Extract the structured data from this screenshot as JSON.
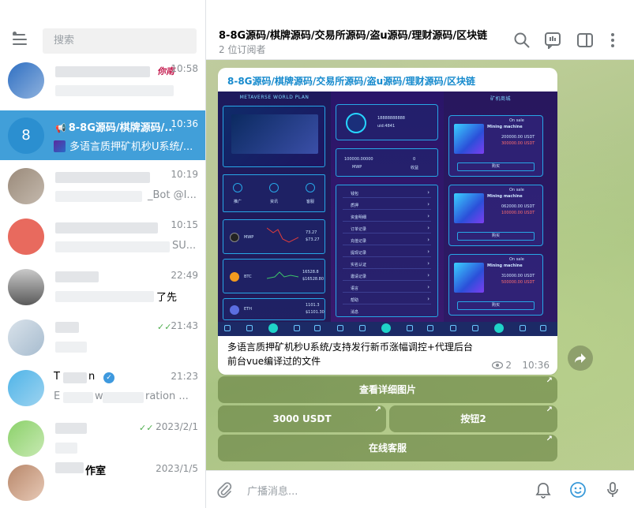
{
  "sidebar": {
    "search_placeholder": "搜索",
    "chats": [
      {
        "time": "10:58",
        "tag": "你南"
      },
      {
        "avatar_letter": "8",
        "title": "8-8G源码/棋牌源码/...",
        "preview": "多语言质押矿机秒U系统/...",
        "time": "10:36"
      },
      {
        "time": "10:19",
        "preview_visible": "_Bot @I..."
      },
      {
        "time": "10:15",
        "preview_visible": "SU..."
      },
      {
        "time": "22:49",
        "preview_visible": "了先"
      },
      {
        "time": "21:43"
      },
      {
        "name_visible": "T",
        "name_visible_end": "n",
        "time": "21:23",
        "preview_visible_start": "E",
        "preview_visible_mid": "w",
        "preview_visible_end": "ration ..."
      },
      {
        "time": "2023/2/1"
      },
      {
        "name_visible": "作室",
        "time": "2023/1/5"
      }
    ]
  },
  "header": {
    "title": "8-8G源码/棋牌源码/交易所源码/盗u源码/理财源码/区块链",
    "subtitle": "2 位订阅者"
  },
  "message": {
    "title": "8-8G源码/棋牌源码/交易所源码/盗u源码/理财源码/区块链",
    "caption_line1": "多语言质押矿机秒U系统/支持发行新币涨幅调控+代理后台",
    "caption_line2": "前台vue编译过的文件",
    "views": "2",
    "time": "10:36",
    "image": {
      "left_header": "METAVERSE WORLD PLAN",
      "left_stat_value": "100000.00000",
      "left_stat_label": "MWP",
      "left_stat2_value": "0",
      "left_stat2_label": "收益",
      "phone_number": "18888888888",
      "user_id": "uid:4841",
      "nav_items": [
        "推广",
        "资讯",
        "客服"
      ],
      "coins": [
        {
          "name": "MWP",
          "value1": "73.27",
          "value2": "$73.27"
        },
        {
          "name": "BTC",
          "value1": "16528.8",
          "value2": "$16528.80"
        },
        {
          "name": "ETH",
          "value1": "1101.3",
          "value2": "$1101.30"
        }
      ],
      "menu_items": [
        "钱包",
        "质押",
        "资金明细",
        "订单记录",
        "充值记录",
        "提现记录",
        "实名认证",
        "邀请记录",
        "语言",
        "帮助",
        "消息"
      ],
      "right_header": "矿机商城",
      "machines": [
        {
          "name": "Mining machine",
          "badge": "On sale",
          "price1": "200000.00 USDT",
          "price2": "300000.00 USDT",
          "buy": "购买"
        },
        {
          "name": "Mining machine",
          "badge": "On sale",
          "price1": "062000.00 USDT",
          "price2": "100000.00 USDT",
          "buy": "购买"
        },
        {
          "name": "Mining machine",
          "badge": "On sale",
          "price1": "310000.00 USDT",
          "price2": "500000.00 USDT",
          "buy": "购买"
        }
      ]
    }
  },
  "buttons": {
    "details": "查看详细图片",
    "usdt": "3000 USDT",
    "button2": "按钮2",
    "support": "在线客服",
    "arrow": "↗"
  },
  "composer": {
    "placeholder": "广播消息..."
  },
  "colors": {
    "accent": "#419fd9",
    "link": "#168acd",
    "chat_bg": "#b5c78f"
  }
}
